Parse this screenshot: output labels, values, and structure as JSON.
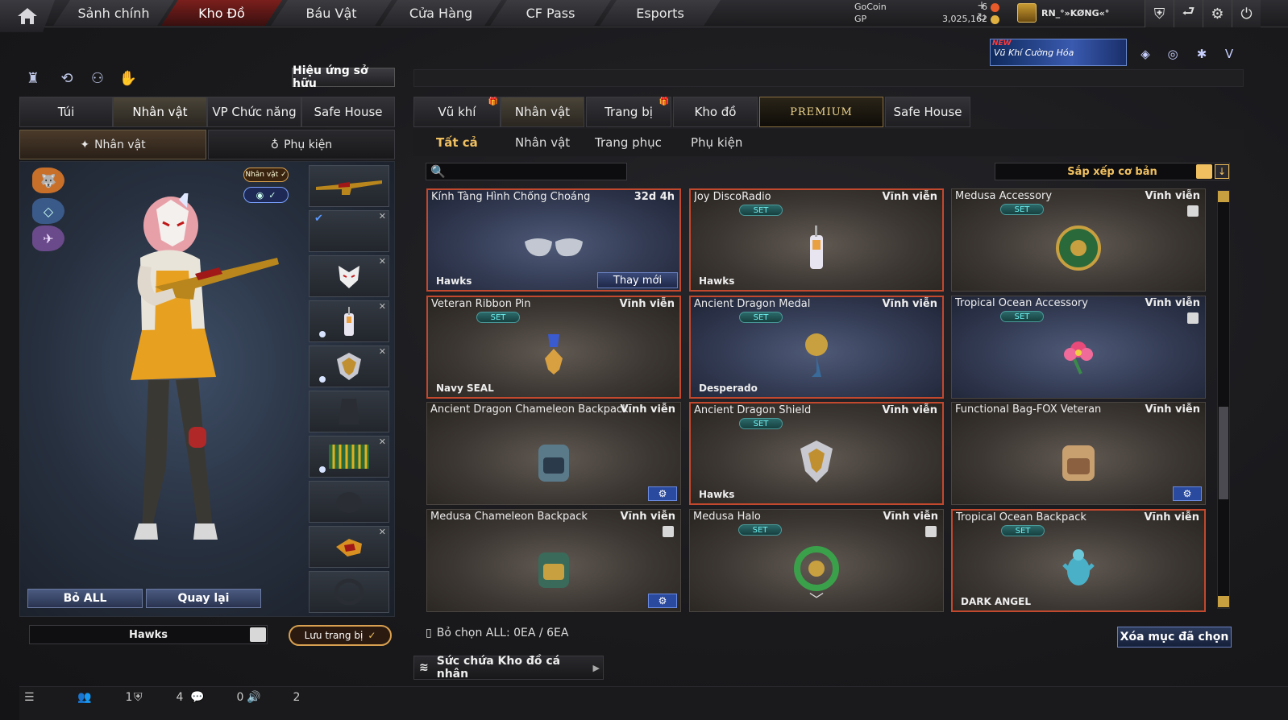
{
  "topbar": {
    "tabs": [
      "Sảnh chính",
      "Kho Đồ",
      "Báu Vật",
      "Cửa Hàng",
      "CF Pass",
      "Esports"
    ],
    "active_tab": "Kho Đồ",
    "gocoin_label": "GoCoin",
    "gocoin_value": "6",
    "gp_label": "GP",
    "gp_value": "3,025,162",
    "username": "RN_°»KØNG«°"
  },
  "banner": {
    "new": "NEW",
    "text": "Vũ Khí Cường Hóa"
  },
  "left": {
    "effect_button": "Hiệu ứng sở hữu",
    "tabs": [
      "Túi",
      "Nhân vật",
      "VP Chức năng",
      "Safe House"
    ],
    "active_tab": "Nhân vật",
    "sub_tabs": [
      "Nhân vật",
      "Phụ kiện"
    ],
    "active_sub": "Nhân vật",
    "char_tag": "Nhân vật ✓",
    "eye_check": "✓",
    "btn_bo_all": "Bỏ ALL",
    "btn_quay_lai": "Quay lại",
    "preset": "Hawks",
    "save_button": "Lưu trang bị",
    "save_check": "✓"
  },
  "right": {
    "tabs": [
      "Vũ khí",
      "Nhân vật",
      "Trang bị",
      "Kho đồ",
      "PREMIUM",
      "Safe House"
    ],
    "active_tab": "Nhân vật",
    "sub_tabs": [
      "Tất cả",
      "Nhân vật",
      "Trang phục",
      "Phụ kiện"
    ],
    "active_sub": "Tất cả",
    "sort_label": "Sắp xếp cơ bản",
    "search_placeholder": "",
    "items": [
      {
        "name": "Kính Tàng Hình Chống Choáng",
        "duration": "32d 4h",
        "team": "Hawks",
        "renew": "Thay mới",
        "icon": "goggles",
        "set": ""
      },
      {
        "name": "Joy DiscoRadio",
        "duration": "Vĩnh viễn",
        "team": "Hawks",
        "icon": "radio",
        "set": "SET"
      },
      {
        "name": "Medusa Accessory",
        "duration": "Vĩnh viễn",
        "team": "",
        "icon": "emblem",
        "set": "SET"
      },
      {
        "name": "Veteran Ribbon Pin",
        "duration": "Vĩnh viễn",
        "team": "Navy SEAL",
        "icon": "medal",
        "set": "SET"
      },
      {
        "name": "Ancient Dragon Medal",
        "duration": "Vĩnh viễn",
        "team": "Desperado",
        "icon": "medallion",
        "set": "SET"
      },
      {
        "name": "Tropical Ocean Accessory",
        "duration": "Vĩnh viễn",
        "team": "",
        "icon": "flower",
        "set": "SET"
      },
      {
        "name": "Ancient Dragon Chameleon Backpack",
        "duration": "Vĩnh viễn",
        "team": "",
        "icon": "backpack",
        "set": ""
      },
      {
        "name": "Ancient Dragon Shield",
        "duration": "Vĩnh viễn",
        "team": "Hawks",
        "icon": "shield",
        "set": "SET"
      },
      {
        "name": "Functional Bag-FOX Veteran",
        "duration": "Vĩnh viễn",
        "team": "",
        "icon": "bag",
        "set": ""
      },
      {
        "name": "Medusa Chameleon Backpack",
        "duration": "Vĩnh viễn",
        "team": "",
        "icon": "backpack-green",
        "set": ""
      },
      {
        "name": "Medusa Halo",
        "duration": "Vĩnh viễn",
        "team": "",
        "icon": "halo",
        "set": "SET"
      },
      {
        "name": "Tropical Ocean Backpack",
        "duration": "Vĩnh viễn",
        "team": "DARK ANGEL",
        "icon": "turtle",
        "set": "SET"
      }
    ],
    "deselect_text": "Bỏ chọn ALL: 0EA / 6EA",
    "delete_button": "Xóa mục đã chọn",
    "capacity_label": "Sức chứa Kho đồ cá nhân"
  },
  "bottombar": {
    "friends": "1",
    "clan": "4",
    "chat": "0",
    "voice": "2"
  },
  "colors": {
    "accent": "#f0c060",
    "selected_border": "#c2482e",
    "set_badge": "#6ef0f0"
  }
}
